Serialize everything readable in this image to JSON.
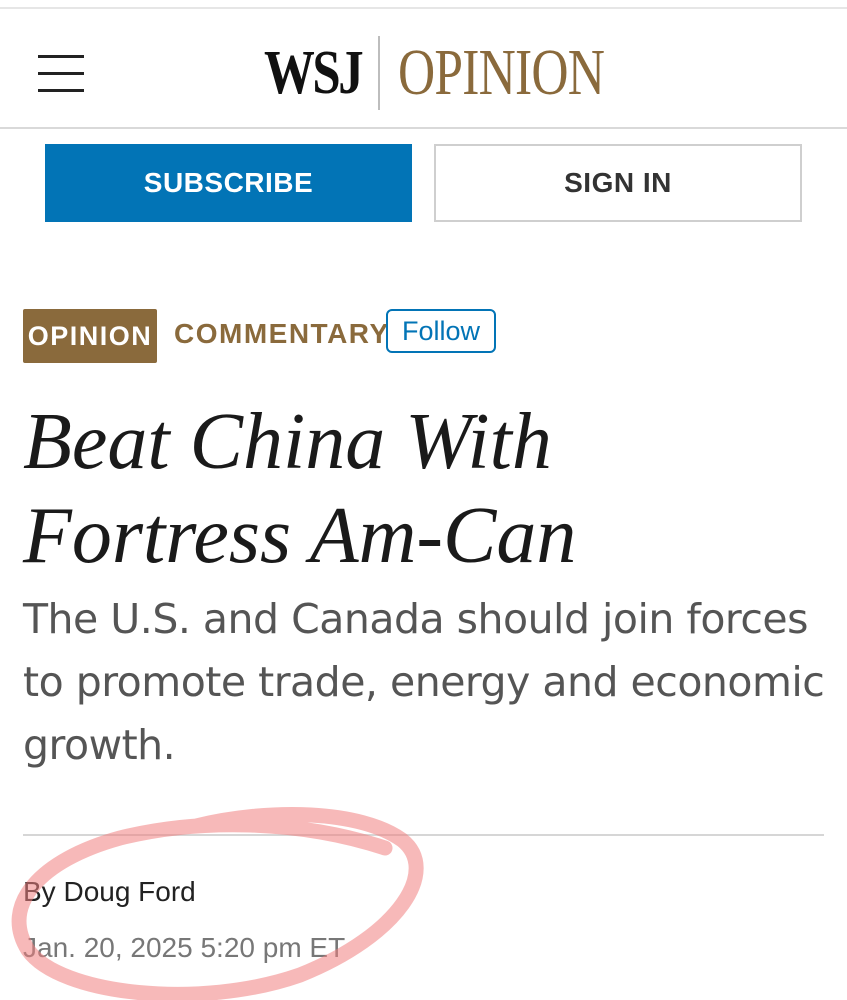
{
  "header": {
    "logo_wsj": "WSJ",
    "logo_section": "OPINION"
  },
  "actions": {
    "subscribe_label": "SUBSCRIBE",
    "signin_label": "SIGN IN"
  },
  "article": {
    "section_tag": "OPINION",
    "category": "COMMENTARY",
    "follow_label": "Follow",
    "headline": "Beat China With Fortress Am-Can",
    "dek": "The U.S. and Canada should join forces to promote trade, energy and economic growth.",
    "byline_prefix": "By",
    "author": "Doug Ford",
    "date": "Jan. 20, 2025 5:20 pm ET"
  },
  "colors": {
    "brand_blue": "#0274b6",
    "opinion_brown": "#8a6a3c",
    "annotation_red": "#f08080"
  },
  "icons": {
    "menu": "hamburger-menu-icon"
  }
}
